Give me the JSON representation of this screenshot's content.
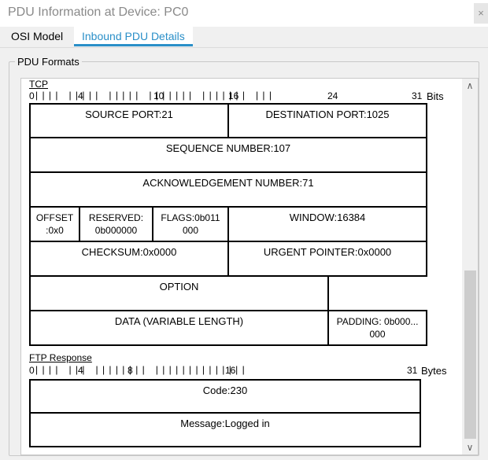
{
  "window": {
    "title": "PDU Information at Device: PC0",
    "close_label": "×"
  },
  "tabs": [
    {
      "label": "OSI Model"
    },
    {
      "label": "Inbound PDU Details"
    }
  ],
  "group_label": "PDU Formats",
  "tcp": {
    "title": "TCP",
    "ruler_marks": [
      "0",
      "4",
      "10",
      "16",
      "24",
      "31"
    ],
    "units": "Bits",
    "rows": [
      [
        "SOURCE PORT:21",
        "DESTINATION PORT:1025"
      ],
      [
        "SEQUENCE NUMBER:107"
      ],
      [
        "ACKNOWLEDGEMENT NUMBER:71"
      ],
      [
        "OFFSET :0x0",
        "RESERVED: 0b000000",
        "FLAGS:0b011 000",
        "WINDOW:16384"
      ],
      [
        "CHECKSUM:0x0000",
        "URGENT POINTER:0x0000"
      ],
      [
        "OPTION",
        ""
      ],
      [
        "DATA (VARIABLE LENGTH)",
        "PADDING: 0b000... 000"
      ]
    ]
  },
  "ftp": {
    "title": "FTP Response",
    "ruler_marks": [
      "0",
      "4",
      "8",
      "16",
      "31"
    ],
    "units": "Bytes",
    "rows": [
      [
        "Code:230"
      ],
      [
        "Message:Logged in"
      ]
    ]
  },
  "scrollbar": {
    "up": "∧",
    "down": "∨"
  }
}
